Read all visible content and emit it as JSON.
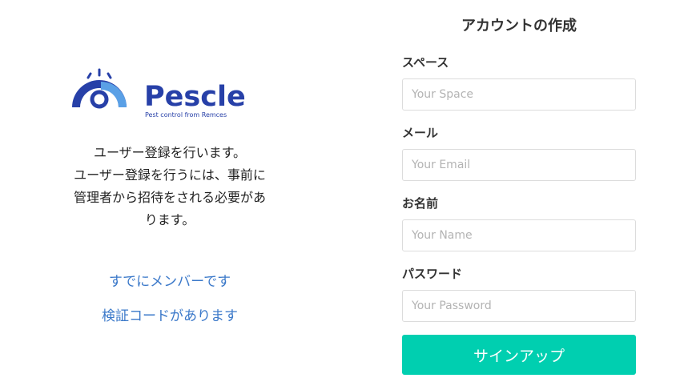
{
  "logo": {
    "brand": "Pescle",
    "tagline": "Pest control from Remces"
  },
  "intro": {
    "lines": [
      "ユーザー登録を行います。",
      "ユーザー登録を行うには、事前に",
      "管理者から招待をされる必要があ",
      "ります。"
    ]
  },
  "links": {
    "already_member": "すでにメンバーです",
    "have_code": "検証コードがあります"
  },
  "form": {
    "title": "アカウントの作成",
    "fields": [
      {
        "label": "スペース",
        "placeholder": "Your Space",
        "value": ""
      },
      {
        "label": "メール",
        "placeholder": "Your Email",
        "value": ""
      },
      {
        "label": "お名前",
        "placeholder": "Your Name",
        "value": ""
      },
      {
        "label": "パスワード",
        "placeholder": "Your Password",
        "value": ""
      }
    ],
    "submit_label": "サインアップ"
  },
  "colors": {
    "accent": "#00cfb0",
    "link": "#3a78c9",
    "logo_dark": "#2740a8",
    "logo_light": "#5aa0e6"
  }
}
